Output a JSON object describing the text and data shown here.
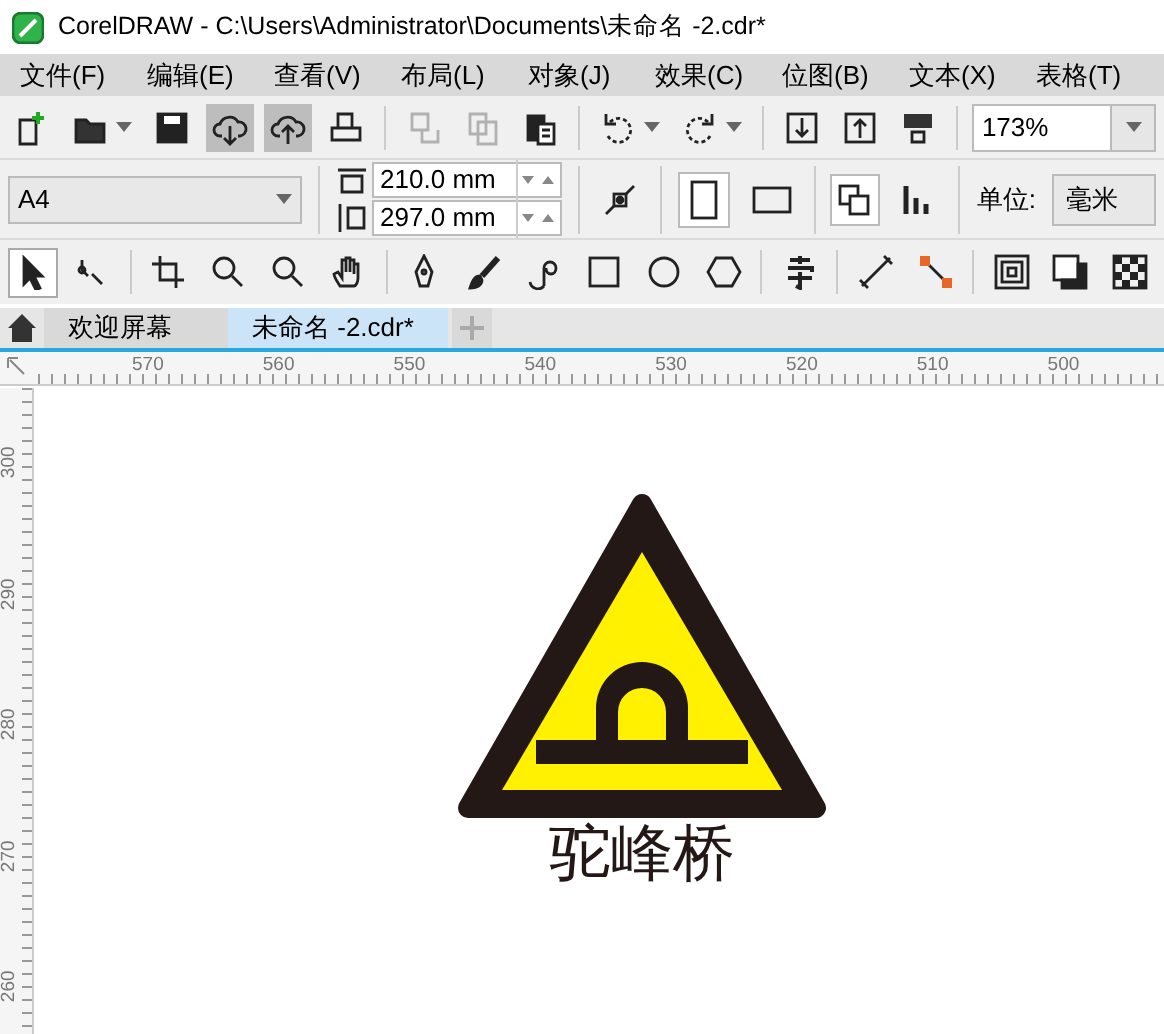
{
  "window": {
    "title": "CorelDRAW - C:\\Users\\Administrator\\Documents\\未命名 -2.cdr*"
  },
  "menu": [
    "文件(F)",
    "编辑(E)",
    "查看(V)",
    "布局(L)",
    "对象(J)",
    "效果(C)",
    "位图(B)",
    "文本(X)",
    "表格(T)"
  ],
  "toolbar": {
    "buttons": [
      {
        "pressed": false,
        "disabled": false
      },
      {
        "pressed": false,
        "disabled": false
      },
      {
        "pressed": false,
        "disabled": false
      },
      {
        "pressed": true,
        "disabled": false
      },
      {
        "pressed": true,
        "disabled": false
      },
      {
        "pressed": false,
        "disabled": false
      },
      {
        "pressed": false,
        "disabled": true
      },
      {
        "pressed": false,
        "disabled": true
      },
      {
        "pressed": false,
        "disabled": false
      },
      {
        "pressed": false,
        "disabled": false
      },
      {
        "pressed": false,
        "disabled": false
      },
      {
        "pressed": false,
        "disabled": false
      },
      {
        "pressed": false,
        "disabled": false
      },
      {
        "pressed": false,
        "disabled": false
      }
    ],
    "zoom": "173%"
  },
  "property_bar": {
    "page_size": "A4",
    "width": "210.0 mm",
    "height": "297.0 mm",
    "orientation": [
      {
        "selected": true
      },
      {
        "selected": false
      }
    ],
    "page_layout": [
      {
        "selected": true
      },
      {
        "selected": false
      }
    ],
    "units_label": "单位:",
    "units": "毫米"
  },
  "toolbox": [
    {
      "selected": true
    },
    {
      "selected": false
    },
    {
      "selected": false
    },
    {
      "selected": false
    },
    {
      "selected": false
    },
    {
      "selected": false
    },
    {
      "selected": false
    },
    {
      "selected": false
    },
    {
      "selected": false
    },
    {
      "selected": false
    },
    {
      "selected": false
    },
    {
      "selected": false
    },
    {
      "selected": false
    },
    {
      "selected": false
    },
    {
      "selected": false
    },
    {
      "selected": false
    },
    {
      "selected": false
    },
    {
      "selected": false
    }
  ],
  "tabs": [
    {
      "label": "欢迎屏幕",
      "selected": false
    },
    {
      "label": "未命名 -2.cdr*",
      "selected": true
    }
  ],
  "ruler": {
    "horizontal": [
      "570",
      "560",
      "550",
      "540",
      "530",
      "520",
      "510",
      "500"
    ],
    "vertical": [
      "300",
      "290",
      "280",
      "270",
      "260"
    ]
  },
  "canvas": {
    "caption": "驼峰桥"
  }
}
